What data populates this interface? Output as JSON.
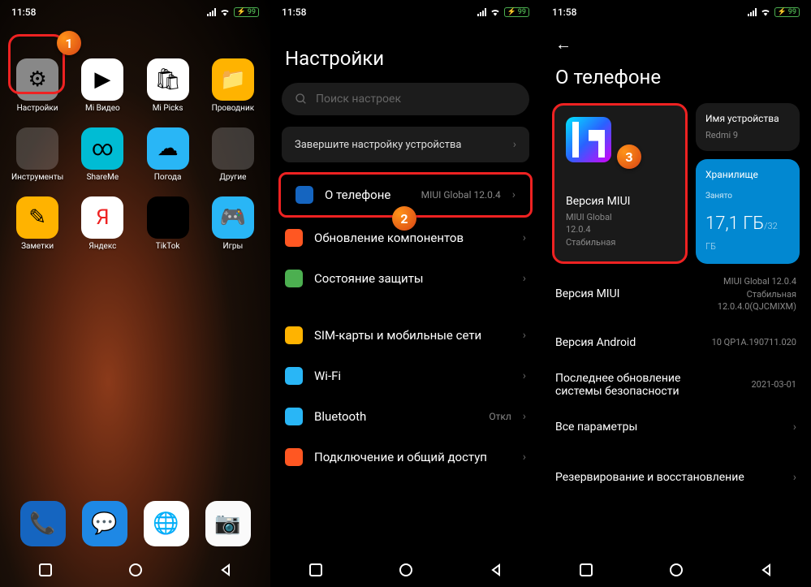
{
  "status": {
    "time": "11:58",
    "battery": "99"
  },
  "s1": {
    "apps": [
      {
        "label": "Настройки",
        "bg": "#888",
        "glyph": "⚙"
      },
      {
        "label": "Mi Видео",
        "bg": "#fff",
        "glyph": "▶"
      },
      {
        "label": "Mi Picks",
        "bg": "#fff",
        "glyph": "🛍"
      },
      {
        "label": "Проводник",
        "bg": "#ffb300",
        "glyph": "📁"
      },
      {
        "label": "Инструменты",
        "bg": "folder"
      },
      {
        "label": "ShareMe",
        "bg": "#00bcd4",
        "glyph": "∞"
      },
      {
        "label": "Погода",
        "bg": "#29b6f6",
        "glyph": "☁"
      },
      {
        "label": "Другие",
        "bg": "folder"
      },
      {
        "label": "Заметки",
        "bg": "#ffb300",
        "glyph": "✎"
      },
      {
        "label": "Яндекс",
        "bg": "#fff",
        "glyph": "Я",
        "color": "#e22"
      },
      {
        "label": "TikTok",
        "bg": "#000",
        "glyph": "♪"
      },
      {
        "label": "Игры",
        "bg": "#29b6f6",
        "glyph": "🎮"
      }
    ],
    "dock": [
      {
        "bg": "#1565c0",
        "glyph": "📞"
      },
      {
        "bg": "#1e88e5",
        "glyph": "💬"
      },
      {
        "bg": "#fff",
        "glyph": "🌐"
      },
      {
        "bg": "#fafafa",
        "glyph": "📷"
      }
    ]
  },
  "s2": {
    "title": "Настройки",
    "search": "Поиск настроек",
    "setup": "Завершите настройку устройства",
    "items": [
      {
        "icon_bg": "#1565c0",
        "label": "О телефоне",
        "value": "MIUI Global 12.0.4"
      },
      {
        "icon_bg": "#ff5722",
        "label": "Обновление компонентов"
      },
      {
        "icon_bg": "#4caf50",
        "label": "Состояние защиты"
      }
    ],
    "items2": [
      {
        "icon_bg": "#ffb300",
        "label": "SIM-карты и мобильные сети"
      },
      {
        "icon_bg": "#29b6f6",
        "label": "Wi-Fi",
        "value": " "
      },
      {
        "icon_bg": "#29b6f6",
        "label": "Bluetooth",
        "value": "Откл"
      },
      {
        "icon_bg": "#ff5722",
        "label": "Подключение и общий доступ"
      }
    ]
  },
  "s3": {
    "title": "О телефоне",
    "miui_card": {
      "title": "Версия MIUI",
      "sub": "MIUI Global\n12.0.4\nСтабильная"
    },
    "device": {
      "title": "Имя устройства",
      "value": "Redmi 9"
    },
    "storage": {
      "title": "Хранилище",
      "label": "Занято",
      "used": "17,1 ГБ",
      "total": "/32 ГБ"
    },
    "rows": [
      {
        "label": "Версия MIUI",
        "value": "MIUI Global 12.0.4\nСтабильная\n12.0.4.0(QJCMIXM)"
      },
      {
        "label": "Версия Android",
        "value": "10 QP1A.190711.020"
      },
      {
        "label": "Последнее обновление системы безопасности",
        "value": "2021-03-01"
      },
      {
        "label": "Все параметры",
        "value": "",
        "chev": true
      }
    ],
    "backup": "Резервирование и восстановление"
  },
  "badges": {
    "1": "1",
    "2": "2",
    "3": "3"
  }
}
